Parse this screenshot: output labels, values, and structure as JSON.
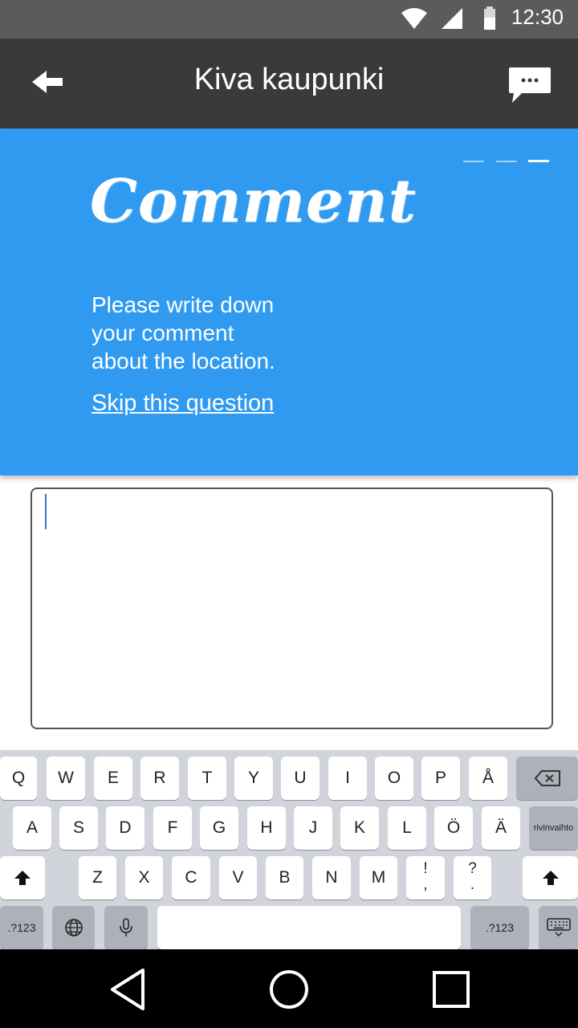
{
  "status_bar": {
    "time": "12:30",
    "icons": [
      "wifi-icon",
      "signal-icon",
      "battery-icon"
    ]
  },
  "app_bar": {
    "title": "Kiva kaupunki",
    "back_icon": "arrow-left-icon",
    "chat_icon": "chat-bubble-icon"
  },
  "question": {
    "heading": "Comment",
    "instruction_lines": [
      "Please write down",
      "your comment",
      "about the location."
    ],
    "skip_label": "Skip this question",
    "progress_steps": 3,
    "progress_current": 3
  },
  "comment_field": {
    "value": "",
    "placeholder": ""
  },
  "keyboard": {
    "row1": [
      "Q",
      "W",
      "E",
      "R",
      "T",
      "Y",
      "U",
      "I",
      "O",
      "P",
      "Å"
    ],
    "row2": [
      "A",
      "S",
      "D",
      "F",
      "G",
      "H",
      "J",
      "K",
      "L",
      "Ö",
      "Ä"
    ],
    "row3": [
      "Z",
      "X",
      "C",
      "V",
      "B",
      "N",
      "M"
    ],
    "punct1_top": "!",
    "punct1_bottom": ",",
    "punct2_top": "?",
    "punct2_bottom": ".",
    "enter_label": "rivinvaihto",
    "symbols_label": ".?123",
    "symbols_label_right": ".?123"
  },
  "colors": {
    "panel": "#2f9af0",
    "app_bar": "#3a3a3a",
    "status_bar": "#5b5b5b",
    "keyboard_bg": "#d1d4da",
    "caret": "#3b6fd6"
  }
}
